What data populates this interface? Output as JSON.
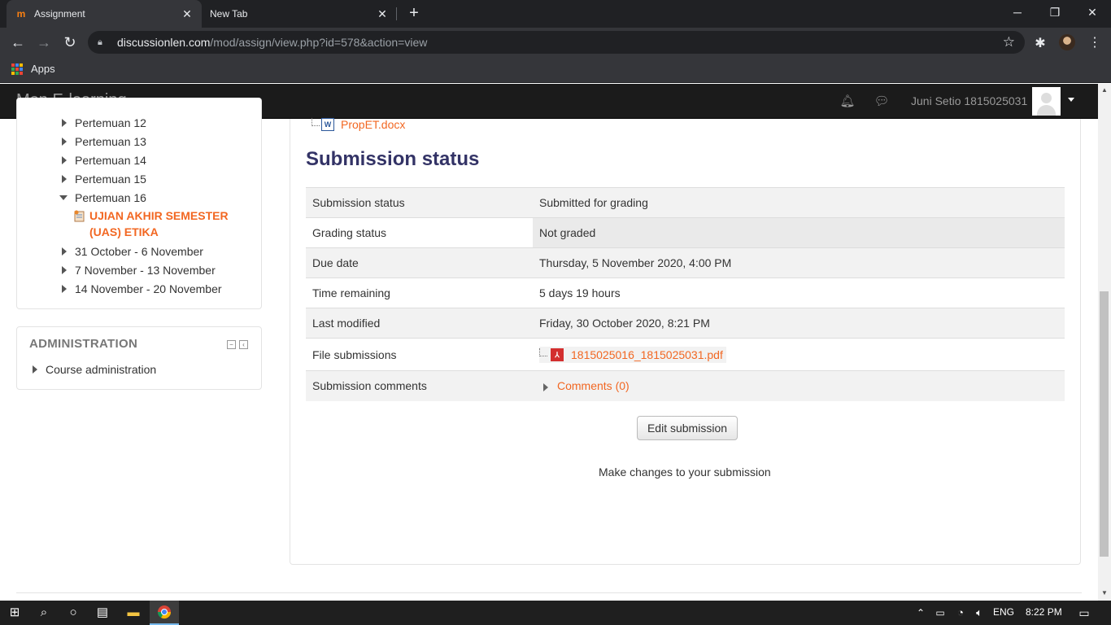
{
  "browser": {
    "tabs": [
      {
        "title": "Assignment",
        "favicon": "moodle-icon",
        "active": true
      },
      {
        "title": "New Tab",
        "active": false
      }
    ],
    "new_tab_label": "+",
    "url_host": "discussionlen.com",
    "url_path": "/mod/assign/view.php?id=578&action=view",
    "bookmarks": [
      {
        "label": "Apps",
        "icon": "apps-grid-icon"
      }
    ]
  },
  "header": {
    "brand": "Mon E-learning",
    "user_name": "Juni Setio 1815025031"
  },
  "sidebar": {
    "navigation_items": [
      {
        "label": "Pertemuan 12",
        "expanded": false
      },
      {
        "label": "Pertemuan 13",
        "expanded": false
      },
      {
        "label": "Pertemuan 14",
        "expanded": false
      },
      {
        "label": "Pertemuan 15",
        "expanded": false
      },
      {
        "label": "Pertemuan 16",
        "expanded": true
      },
      {
        "label": "31 October - 6 November",
        "expanded": false
      },
      {
        "label": "7 November - 13 November",
        "expanded": false
      },
      {
        "label": "14 November - 20 November",
        "expanded": false
      }
    ],
    "quiz_link": "UJIAN AKHIR SEMESTER (UAS) ETIKA",
    "administration": {
      "title": "ADMINISTRATION",
      "items": [
        {
          "label": "Course administration"
        }
      ]
    }
  },
  "main": {
    "attached_file": "PropET.docx",
    "section_title": "Submission status",
    "rows": [
      {
        "label": "Submission status",
        "value": "Submitted for grading"
      },
      {
        "label": "Grading status",
        "value": "Not graded"
      },
      {
        "label": "Due date",
        "value": "Thursday, 5 November 2020, 4:00 PM"
      },
      {
        "label": "Time remaining",
        "value": "5 days 19 hours"
      },
      {
        "label": "Last modified",
        "value": "Friday, 30 October 2020, 8:21 PM"
      },
      {
        "label": "File submissions",
        "value": "1815025016_1815025031.pdf"
      },
      {
        "label": "Submission comments",
        "value": "Comments (0)"
      }
    ],
    "edit_button": "Edit submission",
    "help_text": "Make changes to your submission"
  },
  "taskbar": {
    "language": "ENG",
    "time": "8:22 PM"
  },
  "colors": {
    "link": "#f26722",
    "navbar": "#1b1b1b",
    "title": "#333366"
  }
}
